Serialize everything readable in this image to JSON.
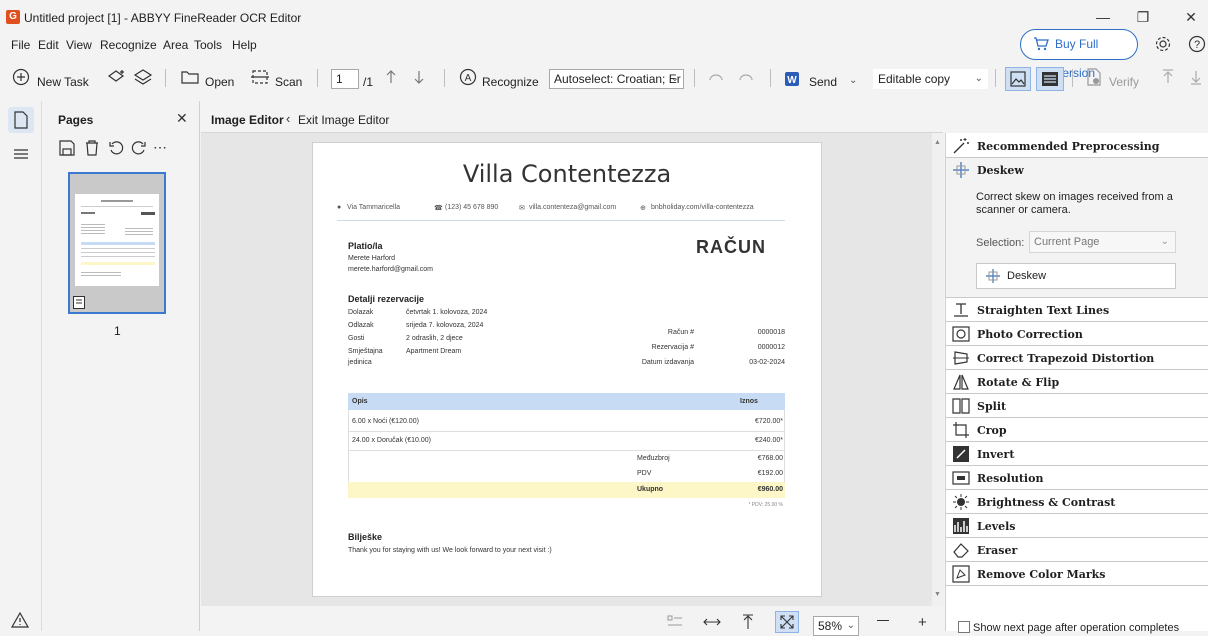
{
  "window": {
    "title": "Untitled project [1] - ABBYY FineReader OCR Editor",
    "logo_letter": "G"
  },
  "menu": [
    "File",
    "Edit",
    "View",
    "Recognize",
    "Area",
    "Tools",
    "Help"
  ],
  "buy_button": "Buy Full Version",
  "toolbar": {
    "new_task": "New Task",
    "open": "Open",
    "scan": "Scan",
    "page_current": "1",
    "page_total": "/1",
    "recognize": "Recognize",
    "language": "Autoselect: Croatian; Er",
    "send": "Send",
    "copy_mode": "Editable copy",
    "verify": "Verify"
  },
  "pages_panel": {
    "title": "Pages",
    "thumbnail_number": "1"
  },
  "editor": {
    "title": "Image Editor",
    "exit": "Exit Image Editor"
  },
  "document": {
    "title": "Villa Contentezza",
    "address": "Via Tammaricella",
    "phone": "(123) 45 678 890",
    "email": "villa.contenteza@gmail.com",
    "website": "bnbholiday.com/villa-contentezza",
    "racun_heading": "RAČUN",
    "platio_heading": "Platio/la",
    "platio_name": "Merete Harford",
    "platio_email": "merete.harford@gmail.com",
    "detalji_heading": "Detalji rezervacije",
    "details": [
      {
        "label": "Dolazak",
        "value": "četvrtak 1. kolovoza, 2024"
      },
      {
        "label": "Odlazak",
        "value": "srijeda 7. kolovoza, 2024"
      },
      {
        "label": "Gosti",
        "value": "2 odraslih, 2 djece"
      },
      {
        "label": "Smještajna",
        "value": "Apartment Dream"
      },
      {
        "label": "jedinica",
        "value": ""
      }
    ],
    "invoice_meta": [
      {
        "label": "Račun #",
        "value": "0000018"
      },
      {
        "label": "Rezervacija #",
        "value": "0000012"
      },
      {
        "label": "Datum izdavanja",
        "value": "03-02-2024"
      }
    ],
    "table_headers": {
      "opis": "Opis",
      "iznos": "Iznos"
    },
    "table_rows": [
      {
        "opis": "6.00 x Noći (€120.00)",
        "iznos": "€720.00*"
      },
      {
        "opis": "24.00 x Doručak (€10.00)",
        "iznos": "€240.00*"
      }
    ],
    "subtotals": [
      {
        "label": "Međuzbroj",
        "value": "€768.00"
      },
      {
        "label": "PDV",
        "value": "€192.00"
      }
    ],
    "total": {
      "label": "Ukupno",
      "value": "€960.00"
    },
    "vat_note": "* PDV: 25.00 %",
    "notes_heading": "Bilješke",
    "notes_text": "Thank you for staying with us! We look forward to your next visit :)"
  },
  "right_panel": {
    "recommended": "Recommended Preprocessing",
    "deskew": "Deskew",
    "deskew_desc": "Correct skew on images received from a scanner or camera.",
    "selection_label": "Selection:",
    "selection_value": "Current Page",
    "deskew_button": "Deskew",
    "tools": [
      "Straighten Text Lines",
      "Photo Correction",
      "Correct Trapezoid Distortion",
      "Rotate & Flip",
      "Split",
      "Crop",
      "Invert",
      "Resolution",
      "Brightness & Contrast",
      "Levels",
      "Eraser",
      "Remove Color Marks"
    ],
    "next_page_option": "Show next page after operation completes"
  },
  "bottom": {
    "zoom": "58%"
  }
}
